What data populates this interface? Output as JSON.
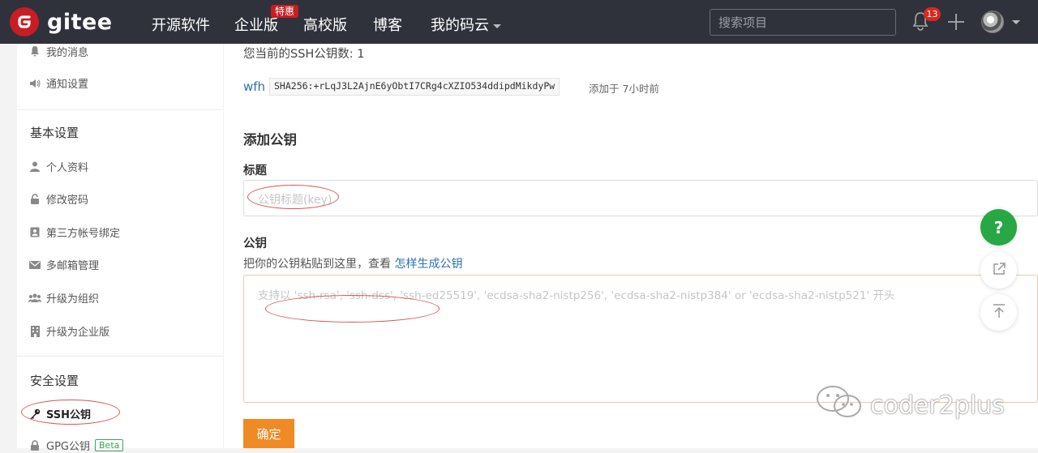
{
  "nav": {
    "logo_text": "gitee",
    "items": [
      "开源软件",
      "企业版",
      "高校版",
      "博客",
      "我的码云"
    ],
    "badge": "特惠",
    "search_placeholder": "搜索项目",
    "notification_count": "13"
  },
  "sidebar": {
    "top_items": [
      "我的消息",
      "通知设置"
    ],
    "basic_heading": "基本设置",
    "basic_items": [
      "个人资料",
      "修改密码",
      "第三方帐号绑定",
      "多邮箱管理",
      "升级为组织",
      "升级为企业版"
    ],
    "security_heading": "安全设置",
    "security_items": [
      "SSH公钥",
      "GPG公钥"
    ],
    "beta_label": "Beta"
  },
  "main": {
    "key_count_text": "您当前的SSH公钥数: 1",
    "key": {
      "title": "wfh",
      "fingerprint": "SHA256:+rLqJ3L2AjnE6yObtI7CRg4cXZIO534ddipdMikdyPw",
      "added": "添加于 7小时前"
    },
    "add_heading": "添加公钥",
    "title_label": "标题",
    "title_placeholder": "公钥标题(key)",
    "key_label": "公钥",
    "key_hint": "把你的公钥粘贴到这里，查看",
    "key_hint_link": "怎样生成公钥",
    "key_placeholder": "支持以 'ssh-rsa', 'ssh-dss', 'ssh-ed25519', 'ecdsa-sha2-nistp256', 'ecdsa-sha2-nistp384' or 'ecdsa-sha2-nistp521' 开头",
    "submit_label": "确定"
  },
  "floating": {
    "help_label": "?"
  },
  "watermark": "coder2plus",
  "colors": {
    "brand": "#c71d23",
    "accent_orange": "#f08a24",
    "link": "#2c6fb7",
    "topbar": "#2f323a"
  }
}
